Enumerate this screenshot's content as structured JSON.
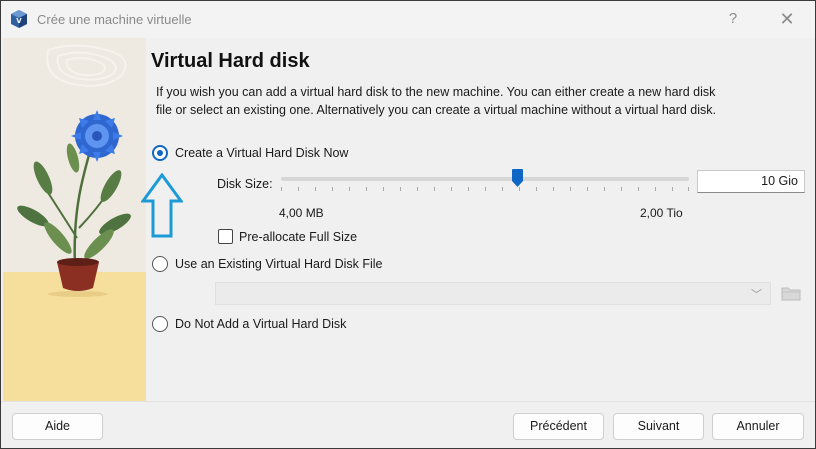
{
  "window": {
    "title": "Crée une machine virtuelle",
    "help_label": "?",
    "close_label": "✕"
  },
  "page": {
    "heading": "Virtual Hard disk",
    "description": "If you wish you can add a virtual hard disk to the new machine. You can either create a new hard disk file or select an existing one. Alternatively you can create a virtual machine without a virtual hard disk."
  },
  "options": {
    "create_label": "Create a Virtual Hard Disk Now",
    "create_checked": true,
    "existing_label": "Use an Existing Virtual Hard Disk File",
    "existing_checked": false,
    "none_label": "Do Not Add a Virtual Hard Disk",
    "none_checked": false
  },
  "disk_size": {
    "label": "Disk Size:",
    "value": "10 Gio",
    "min_label": "4,00 MB",
    "max_label": "2,00 Tio",
    "slider_position_fraction": 0.58
  },
  "preallocate": {
    "label": "Pre-allocate Full Size",
    "checked": false
  },
  "existing_file": {
    "value": "",
    "combo_arrow": "﹀"
  },
  "footer": {
    "help_label": "Aide",
    "back_label": "Précédent",
    "next_label": "Suivant",
    "cancel_label": "Annuler"
  },
  "icons": {
    "app": "virtualbox-icon",
    "folder": "folder-icon",
    "annotation": "up-arrow-icon"
  },
  "colors": {
    "accent": "#0f66c5",
    "annotation_arrow": "#1b9ad6"
  }
}
